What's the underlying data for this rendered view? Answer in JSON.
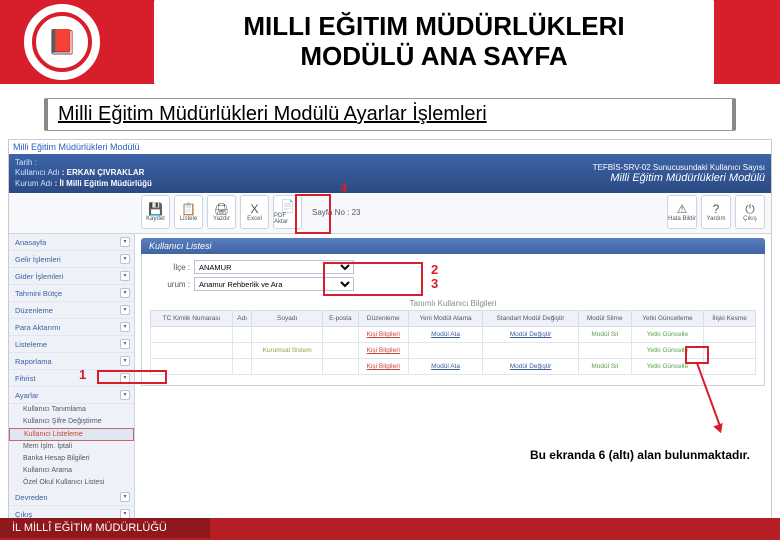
{
  "header": {
    "title_line1": "MILLI EĞITIM MÜDÜRLÜKLERI",
    "title_line2": "MODÜLÜ ANA SAYFA"
  },
  "sub_header": "Milli Eğitim Müdürlükleri Modülü Ayarlar İşlemleri",
  "app_title": "Milli Eğitim Müdürlükleri Modülü",
  "topbar": {
    "label1": "Tarih :",
    "label2": "Kullanıcı Adı",
    "label3": "Kurum Adı",
    "user": ": ERKAN ÇIVRAKLAR",
    "kurum": ": İl Milli Eğitim Müdürlüğü",
    "right1": "TEFBİS-SRV-02 Sunucusundaki Kullanıcı Sayısı",
    "mod_title": "Milli Eğitim Müdürlükleri Modülü"
  },
  "toolbar": {
    "items": [
      {
        "label": "Kaydet",
        "icon": "💾"
      },
      {
        "label": "Listele",
        "icon": "📋"
      },
      {
        "label": "Yazdır",
        "icon": "🖨"
      },
      {
        "label": "Excel",
        "icon": "X"
      },
      {
        "label": "PDF Aktar",
        "icon": "📄"
      }
    ],
    "page_no": "Sayfa No : 23",
    "right": [
      {
        "label": "Hata Bildir",
        "icon": "⚠"
      },
      {
        "label": "Yardım",
        "icon": "?"
      },
      {
        "label": "Çıkış",
        "icon": "⏻"
      }
    ]
  },
  "sidebar": {
    "groups": [
      "Anasayfa",
      "Gelir İşlemleri",
      "Gider İşlemleri",
      "Tahmini Bütçe",
      "Düzenleme",
      "Para Aktarımı",
      "Listeleme",
      "Raporlama",
      "Fihrist",
      "Ayarlar"
    ],
    "subs": [
      "Kullanıcı Tanımlama",
      "Kullanıcı Şifre Değiştirme",
      "Kullanıcı Listeleme",
      "Mem İşlm. İptali",
      "Banka Hesap Bilgileri",
      "Kullanıcı Arama",
      "Özel Okul Kullanıcı Listesi"
    ],
    "groups2": [
      "Devreden",
      "Çıkış"
    ]
  },
  "panel": {
    "title": "Kullanıcı Listesi",
    "filter_ilce_label": "İlçe :",
    "filter_ilce_value": "ANAMUR",
    "filter_kurum_label": "urum :",
    "filter_kurum_value": "Anamur Rehberlik ve Ara",
    "sub_head": "Tanımlı Kullanıcı Bilgileri",
    "columns": [
      "TC Kimlik Numarası",
      "Adı",
      "Soyadı",
      "E-posta",
      "Düzenleme",
      "Yeni Modül Atama",
      "Standart Modül Değiştir",
      "Modül Silme",
      "Yetki Güncelleme",
      "İlişki Kesme"
    ],
    "rows": [
      [
        "",
        "",
        "",
        "",
        "Kişi Bilgileri",
        "Modül Ata",
        "Modül Değiştir",
        "Modül Sil",
        "Yetki Güncelle",
        ""
      ],
      [
        "",
        "",
        "Kurumsal Sistem",
        "",
        "Kişi Bilgileri",
        "",
        "",
        "",
        "Yetki Güncelle",
        ""
      ],
      [
        "",
        "",
        "",
        "",
        "Kişi Bilgileri",
        "Modül Ata",
        "Modül Değiştir",
        "Modül Sil",
        "Yetki Güncelle",
        ""
      ]
    ]
  },
  "annotations": {
    "n1": "1",
    "n2": "2",
    "n3": "3",
    "n4": "4"
  },
  "caption": "Bu ekranda 6 (altı) alan bulunmaktadır.",
  "footer": "İL MİLLÎ EĞİTİM MÜDÜRLÜĞÜ"
}
